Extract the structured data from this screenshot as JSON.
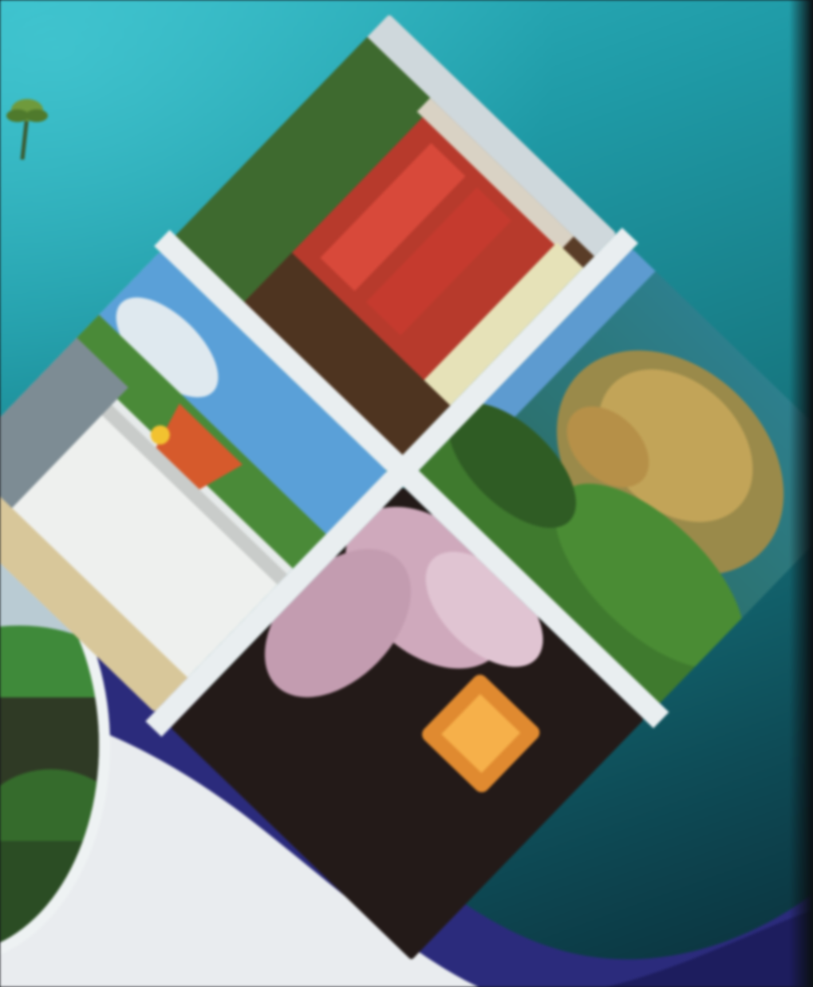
{
  "scene": {
    "subject": "photo-of-printed-travel-brochure",
    "colors": {
      "teal": "#1f9aa6",
      "navy": "#2a2a7a",
      "white": "#eef2f3",
      "frame": "#e9eef0"
    },
    "tiles": [
      {
        "name": "rock-fortress-photo",
        "colors": [
          "#6f8a4a",
          "#b89a52",
          "#3e7a2e"
        ]
      },
      {
        "name": "red-temple-photo",
        "colors": [
          "#c8342c",
          "#7a2a22",
          "#5b3a24"
        ]
      },
      {
        "name": "cherry-blossom-photo",
        "colors": [
          "#d6b7c6",
          "#2a1e1a",
          "#f0a040"
        ]
      },
      {
        "name": "white-temple-photo",
        "colors": [
          "#e8ebe8",
          "#d5602e",
          "#4b8d3a"
        ]
      }
    ]
  }
}
